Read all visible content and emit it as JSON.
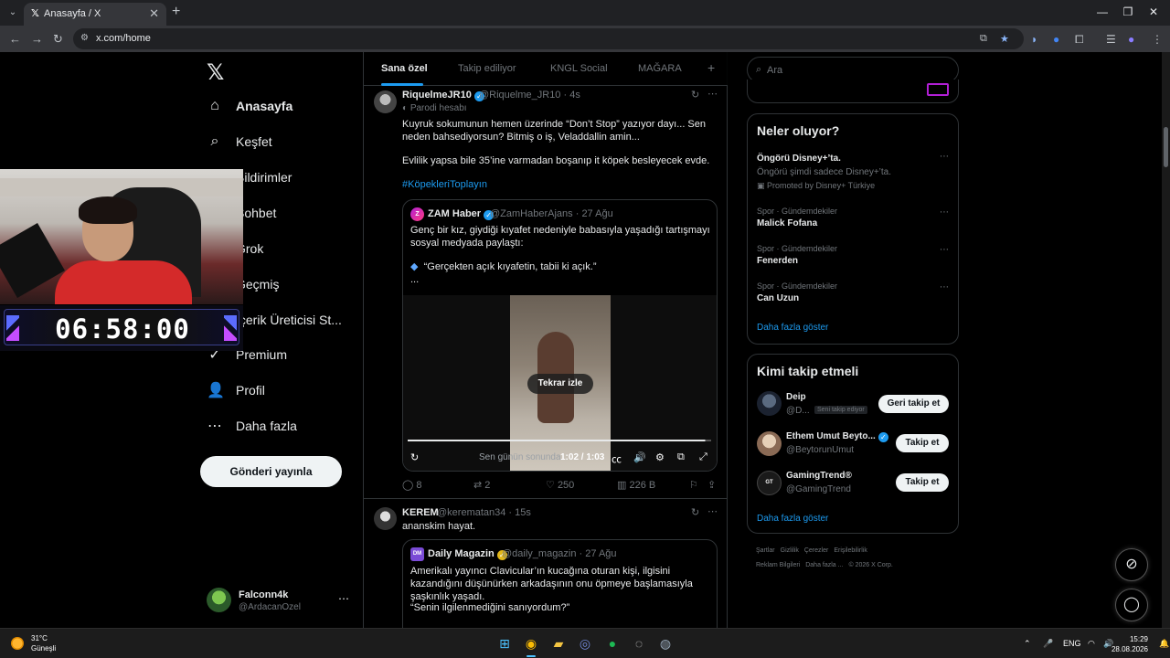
{
  "browser": {
    "tab_title": "Anasayfa / X",
    "url": "x.com/home",
    "tab_close": "✕",
    "new_tab": "+"
  },
  "nav": {
    "items": [
      {
        "label": "Anasayfa",
        "icon": "home-icon"
      },
      {
        "label": "Keşfet",
        "icon": "search-icon"
      },
      {
        "label": "Bildirimler",
        "icon": "bell-icon"
      },
      {
        "label": "Sohbet",
        "icon": "chat-icon"
      },
      {
        "label": "Grok",
        "icon": "grok-icon"
      },
      {
        "label": "Geçmiş",
        "icon": "bookmark-icon"
      },
      {
        "label": "İçerik Üreticisi St...",
        "icon": "creator-icon"
      },
      {
        "label": "Premium",
        "icon": "premium-icon"
      },
      {
        "label": "Profil",
        "icon": "profile-icon"
      },
      {
        "label": "Daha fazla",
        "icon": "more-icon"
      }
    ],
    "post_button": "Gönderi yayınla",
    "account": {
      "name": "Falconn4k",
      "handle": "@ArdacanOzel"
    }
  },
  "overlay": {
    "timer": "06:58:00"
  },
  "feed": {
    "tabs": [
      "Sana özel",
      "Takip ediliyor",
      "KNGL Social",
      "MAĞARA"
    ],
    "tweets": [
      {
        "name": "RiquelmeJR10",
        "handle": "@Riquelme_JR10",
        "time": "4s",
        "label": "Parodi hesabı",
        "text1": "Kuyruk sokumunun hemen üzerinde “Don’t Stop” yazıyor dayı... Sen neden bahsediyorsun? Bitmiş o iş, Veladdallin amin...",
        "text2": "Evlilik yapsa bile 35’ine varmadan boşanıp it köpek besleyecek evde.",
        "hashtag": "#KöpekleriToplayın",
        "quote": {
          "name": "ZAM Haber",
          "handle": "@ZamHaberAjans",
          "time": "27 Ağu",
          "text": "Genç bir kız, giydiği kıyafet nedeniyle babasıyla yaşadığı tartışmayı sosyal medyada paylaştı:",
          "bullet": "“Gerçekten açık kıyafetin, tabii ki açık.”",
          "ellipsis": "...",
          "video": {
            "replay": "Tekrar izle",
            "time": "1:02 / 1:03",
            "caption": "Sen günün sonunda",
            "progress": 0.98
          }
        },
        "stats": {
          "replies": "8",
          "reposts": "2",
          "likes": "250",
          "views": "226 B"
        }
      },
      {
        "name": "KEREM",
        "handle": "@kerematan34",
        "time": "15s",
        "text": "ananskim hayat.",
        "quote": {
          "name": "Daily Magazin",
          "handle": "@daily_magazin",
          "time": "27 Ağu",
          "text": "Amerikalı yayıncı Clavicular’ın kucağına oturan kişi, ilgisini kazandığını düşünürken arkadaşının onu öpmeye başlamasıyla şaşkınlık yaşadı.",
          "text2": "“Senin ilgilenmediğini sanıyordum?”"
        }
      }
    ]
  },
  "sidebar": {
    "search_placeholder": "Ara",
    "trends_title": "Neler oluyor?",
    "promo": {
      "name": "Öngörü Disney+’ta.",
      "desc": "Öngörü şimdi sadece Disney+’ta.",
      "by": "Promoted by Disney+ Türkiye"
    },
    "trends": [
      {
        "meta": "Spor · Gündemdekiler",
        "name": "Malick Fofana"
      },
      {
        "meta": "Spor · Gündemdekiler",
        "name": "Fenerden"
      },
      {
        "meta": "Spor · Gündemdekiler",
        "name": "Can Uzun"
      }
    ],
    "show_more": "Daha fazla göster",
    "who_title": "Kimi takip etmeli",
    "who": [
      {
        "name": "Deip",
        "handle": "@D...",
        "badge": "Seni takip ediyor",
        "button": "Geri takip et"
      },
      {
        "name": "Ethem Umut Beyto...",
        "handle": "@BeytorunUmut",
        "button": "Takip et"
      },
      {
        "name": "GamingTrend®",
        "handle": "@GamingTrend",
        "button": "Takip et"
      }
    ],
    "who_more": "Daha fazla göster",
    "footer": [
      "Şartlar",
      "Gizlilik",
      "Çerezler",
      "Erişilebilirlik",
      "Reklam Bilgileri",
      "Daha fazla ...",
      "© 2026 X Corp."
    ]
  },
  "taskbar": {
    "temp": "31°C",
    "weather": "Güneşli",
    "lang": "ENG",
    "time": "15:29",
    "date": "28.08.2026"
  },
  "colors": {
    "accent": "#1d9bf0",
    "background": "#000000",
    "border": "#2f3336"
  }
}
